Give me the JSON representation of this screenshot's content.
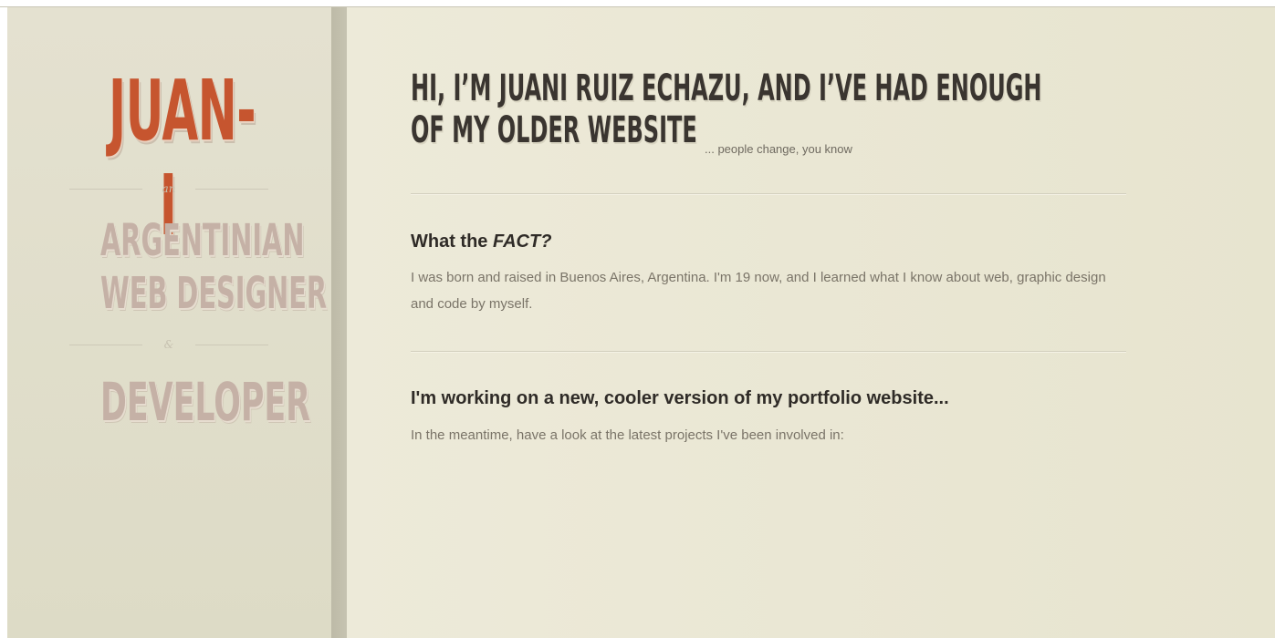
{
  "sidebar": {
    "logo": "JUAN-I",
    "divider_1": "an",
    "role_line_1": "ARGENTINIAN",
    "role_line_2": "WEB DESIGNER",
    "divider_2": "&",
    "role_line_3": "DEVELOPER"
  },
  "main": {
    "headline_line_1": "HI, I’M JUANI RUIZ ECHAZU, AND I’VE HAD ENOUGH",
    "headline_line_2": "OF MY OLDER WEBSITE",
    "tagline": "... people change, you know",
    "sections": [
      {
        "title_prefix": "What the ",
        "title_emphasis": "FACT?",
        "body": "I was born and raised in Buenos Aires, Argentina. I'm 19 now, and I learned what I know about web, graphic design and code by myself."
      },
      {
        "title": "I'm working on a new, cooler version of my portfolio website...",
        "body": "In the meantime, have a look at the latest projects I've been involved in:"
      }
    ]
  },
  "colors": {
    "accent": "#c6552f",
    "role_text": "#c5b1a6",
    "heading_text": "#3a3530",
    "body_text": "#7a7468",
    "background": "#e9e6d2"
  }
}
